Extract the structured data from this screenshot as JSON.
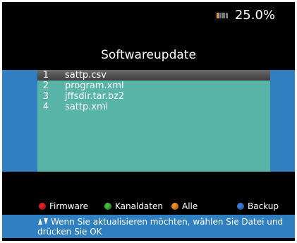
{
  "status": {
    "progress_value": "25.0%",
    "progress_fraction": 0.25,
    "icon": "progress-meter-icon"
  },
  "header": {
    "title": "Softwareupdate"
  },
  "file_list": {
    "items": [
      {
        "num": "1",
        "name": "sattp.csv",
        "selected": true
      },
      {
        "num": "2",
        "name": "program.xml",
        "selected": false
      },
      {
        "num": "3",
        "name": "jffsdir.tar.bz2",
        "selected": false
      },
      {
        "num": "4",
        "name": "sattp.xml",
        "selected": false
      }
    ]
  },
  "legend": {
    "red": {
      "label": "Firmware",
      "color": "#e02020"
    },
    "green": {
      "label": "Kanaldaten",
      "color": "#3cc03c"
    },
    "orange": {
      "label": "Alle",
      "color": "#f08a20"
    },
    "blue": {
      "label": "Backup",
      "color": "#3a78d8"
    }
  },
  "help": {
    "icon": "up-down-arrows-icon",
    "text": "Wenn Sie aktualisieren möchten, wählen Sie Datei und drücken Sie OK"
  },
  "colors": {
    "background": "#000000",
    "band": "#2f7fc1",
    "panel": "#57b4a7"
  }
}
